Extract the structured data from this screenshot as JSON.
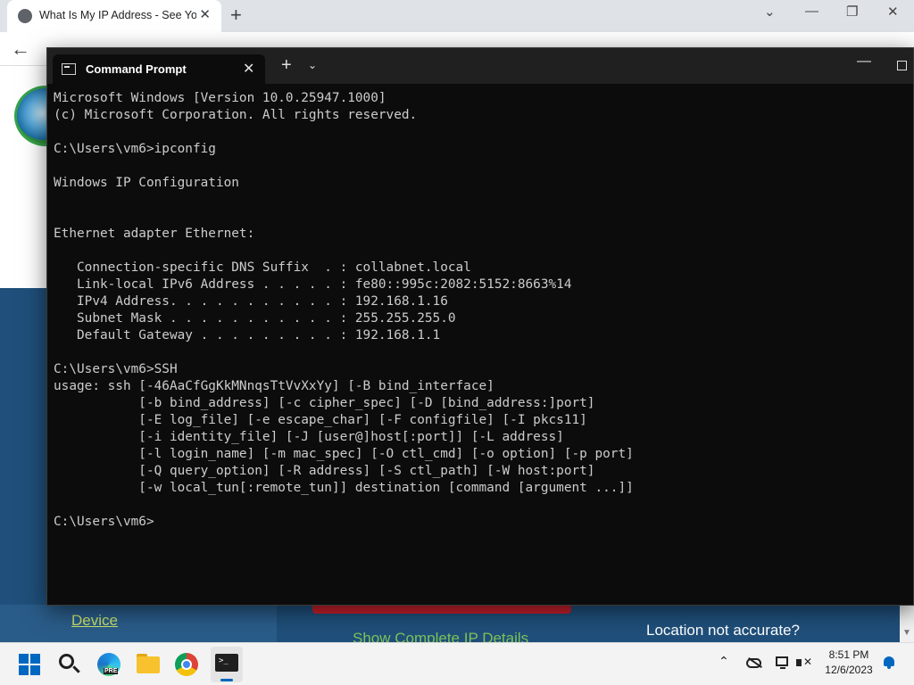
{
  "browser": {
    "tab_title": "What Is My IP Address - See Yo",
    "tab_close": "✕",
    "new_tab": "+",
    "win_minimize": "⌄",
    "win_min2": "—",
    "win_restore": "❐",
    "win_close": "✕",
    "back": "←"
  },
  "website": {
    "device_link": "Device",
    "show_ip_details": "Show Complete IP Details",
    "location_question": "Location not accurate?"
  },
  "terminal": {
    "tab_title": "Command Prompt",
    "tab_close": "✕",
    "new_tab": "+",
    "dropdown": "⌄",
    "minimize": "—",
    "lines": [
      "Microsoft Windows [Version 10.0.25947.1000]",
      "(c) Microsoft Corporation. All rights reserved.",
      "",
      "C:\\Users\\vm6>ipconfig",
      "",
      "Windows IP Configuration",
      "",
      "",
      "Ethernet adapter Ethernet:",
      "",
      "   Connection-specific DNS Suffix  . : collabnet.local",
      "   Link-local IPv6 Address . . . . . : fe80::995c:2082:5152:8663%14",
      "   IPv4 Address. . . . . . . . . . . : 192.168.1.16",
      "   Subnet Mask . . . . . . . . . . . : 255.255.255.0",
      "   Default Gateway . . . . . . . . . : 192.168.1.1",
      "",
      "C:\\Users\\vm6>SSH",
      "usage: ssh [-46AaCfGgKkMNnqsTtVvXxYy] [-B bind_interface]",
      "           [-b bind_address] [-c cipher_spec] [-D [bind_address:]port]",
      "           [-E log_file] [-e escape_char] [-F configfile] [-I pkcs11]",
      "           [-i identity_file] [-J [user@]host[:port]] [-L address]",
      "           [-l login_name] [-m mac_spec] [-O ctl_cmd] [-o option] [-p port]",
      "           [-Q query_option] [-R address] [-S ctl_path] [-W host:port]",
      "           [-w local_tun[:remote_tun]] destination [command [argument ...]]",
      "",
      "C:\\Users\\vm6>"
    ]
  },
  "taskbar": {
    "apps": [
      "start",
      "search",
      "edge-beta",
      "file-explorer",
      "chrome",
      "terminal"
    ],
    "edge_badge": "PRE",
    "terminal_glyph": ">_",
    "tray_chevron": "⌃",
    "volume_mark": "✕",
    "time": "8:51 PM",
    "date": "12/6/2023"
  }
}
